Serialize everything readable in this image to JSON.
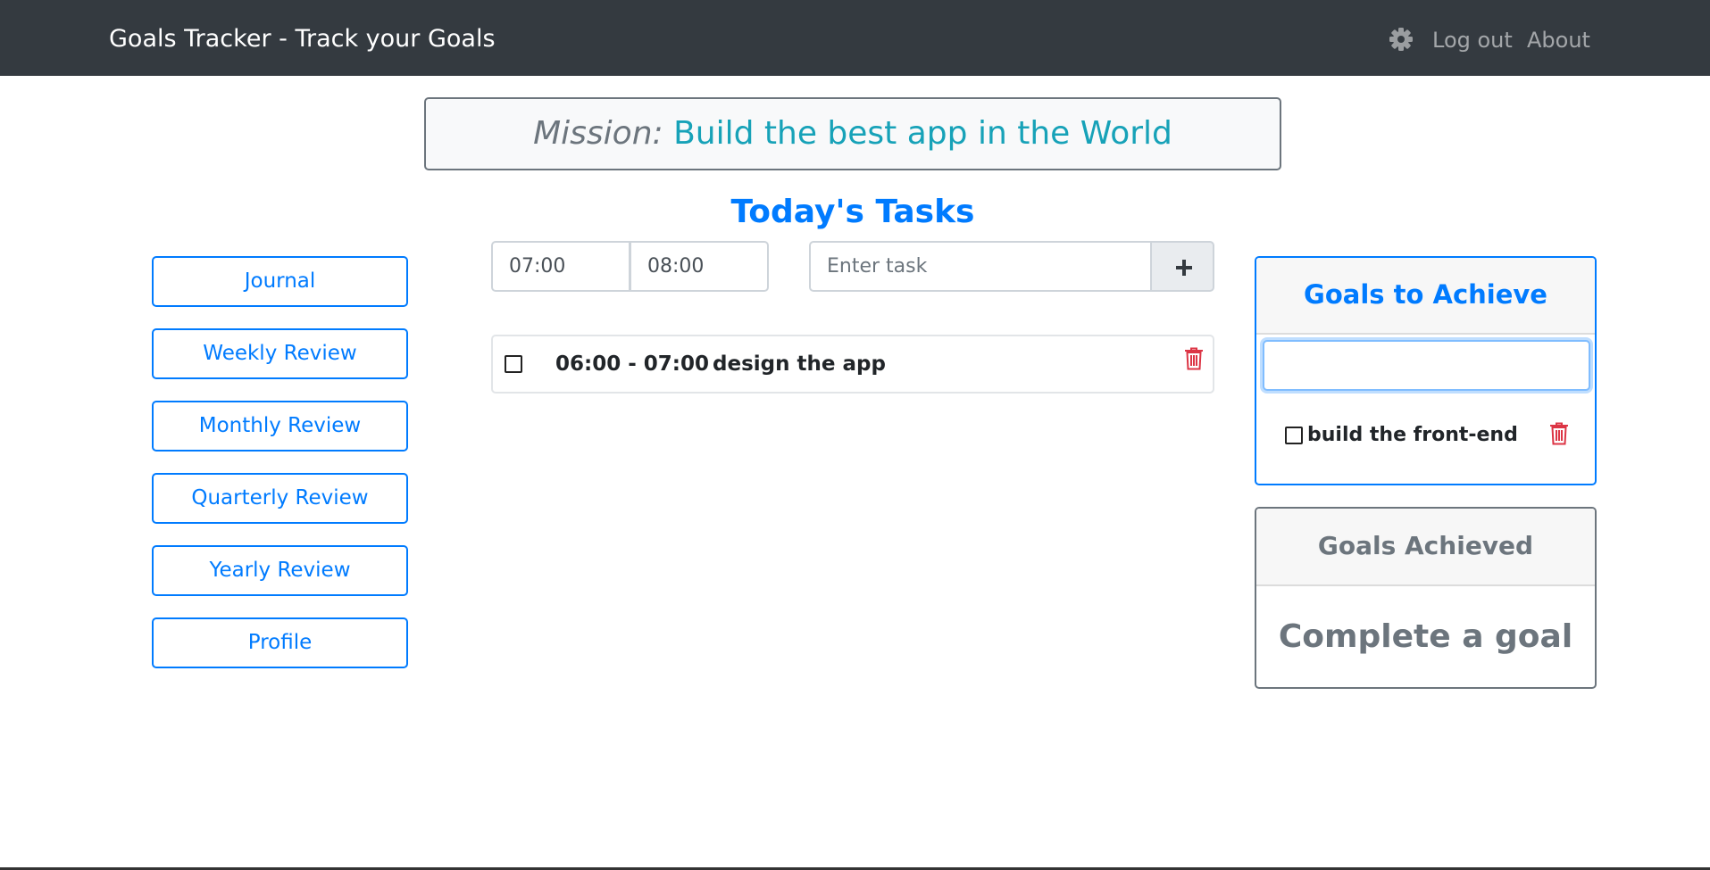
{
  "navbar": {
    "brand": "Goals Tracker - Track your Goals",
    "settings_icon": "gear-icon",
    "logout_label": "Log out",
    "about_label": "About"
  },
  "mission": {
    "label": "Mission:",
    "text": "Build the best app in the World"
  },
  "tasks": {
    "title": "Today's Tasks",
    "start_time": "07:00",
    "end_time": "08:00",
    "task_placeholder": "Enter task",
    "add_icon": "plus-icon",
    "items": [
      {
        "time": "06:00 - 07:00",
        "text": "design the app",
        "done": false,
        "delete_icon": "trash-icon"
      }
    ]
  },
  "sidebar": {
    "items": [
      {
        "label": "Journal"
      },
      {
        "label": "Weekly Review"
      },
      {
        "label": "Monthly Review"
      },
      {
        "label": "Quarterly Review"
      },
      {
        "label": "Yearly Review"
      },
      {
        "label": "Profile"
      }
    ]
  },
  "goals": {
    "title": "Goals to Achieve",
    "input_value": "",
    "items": [
      {
        "text": "build the front-end",
        "done": false,
        "delete_icon": "trash-icon"
      }
    ]
  },
  "achieved": {
    "title": "Goals Achieved",
    "empty_text": "Complete a goal"
  },
  "colors": {
    "navbar_bg": "#343a40",
    "primary": "#007bff",
    "info": "#17a2b8",
    "secondary": "#6c757d",
    "danger": "#dc3545"
  }
}
